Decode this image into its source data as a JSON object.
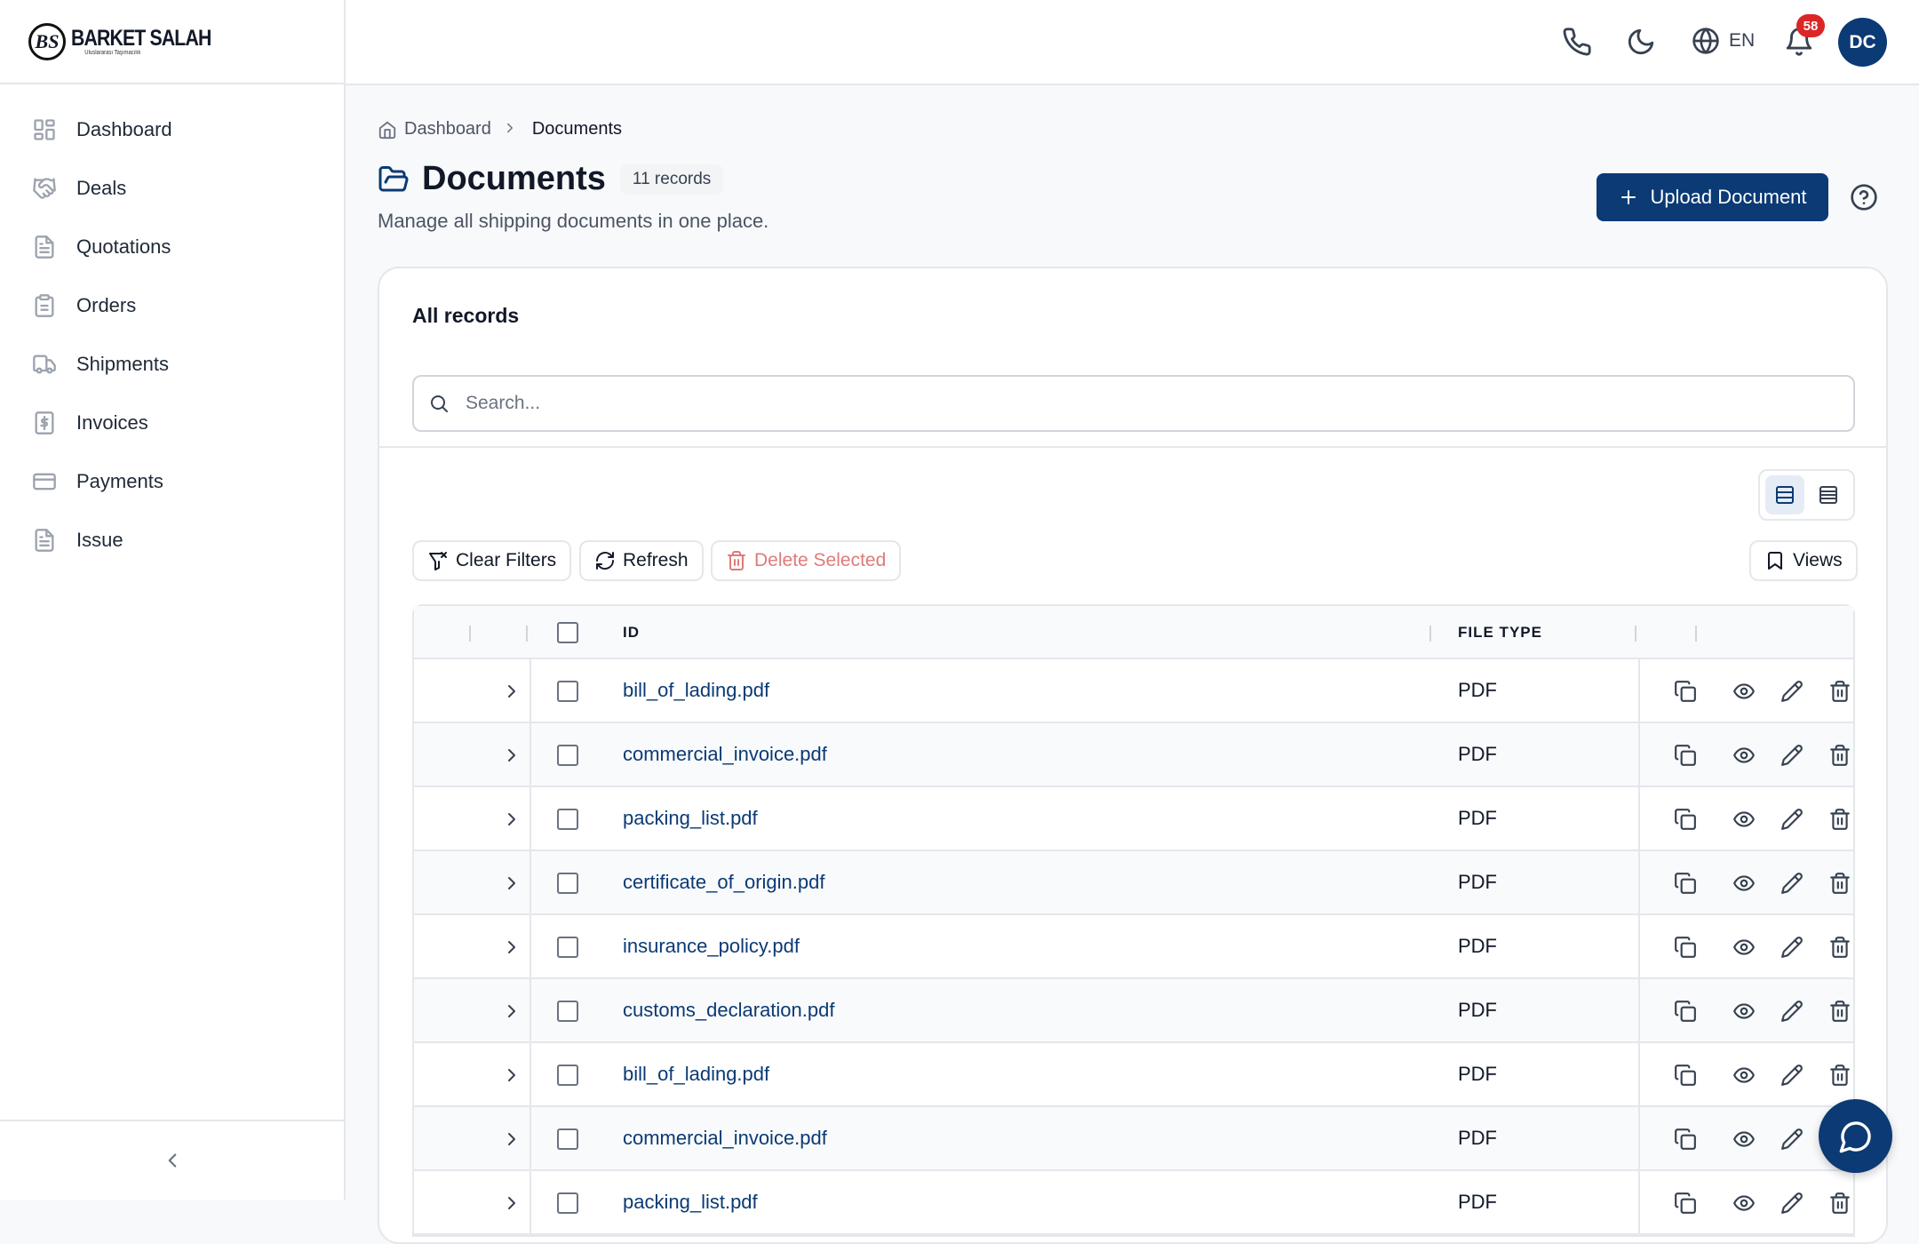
{
  "brand": {
    "mark": "BS",
    "name": "BARKET SALAH",
    "tagline": "Uluslararası Taşımacılık"
  },
  "sidebar": {
    "items": [
      {
        "label": "Dashboard",
        "icon": "grid-icon"
      },
      {
        "label": "Deals",
        "icon": "handshake-icon"
      },
      {
        "label": "Quotations",
        "icon": "document-icon"
      },
      {
        "label": "Orders",
        "icon": "clipboard-icon"
      },
      {
        "label": "Shipments",
        "icon": "truck-icon"
      },
      {
        "label": "Invoices",
        "icon": "invoice-icon"
      },
      {
        "label": "Payments",
        "icon": "credit-card-icon"
      },
      {
        "label": "Issue",
        "icon": "document-icon"
      }
    ]
  },
  "header": {
    "language": "EN",
    "notifications_count": "58",
    "avatar_initials": "DC"
  },
  "breadcrumb": {
    "home": "Dashboard",
    "current": "Documents"
  },
  "page": {
    "title": "Documents",
    "record_count": "11 records",
    "subtitle": "Manage all shipping documents in one place.",
    "upload_label": "Upload Document"
  },
  "card": {
    "title": "All records",
    "search_placeholder": "Search...",
    "toolbar": {
      "clear_filters": "Clear Filters",
      "refresh": "Refresh",
      "delete_selected": "Delete Selected",
      "views": "Views"
    }
  },
  "table": {
    "columns": {
      "id": "ID",
      "file_type": "FILE TYPE"
    },
    "rows": [
      {
        "id": "bill_of_lading.pdf",
        "file_type": "PDF"
      },
      {
        "id": "commercial_invoice.pdf",
        "file_type": "PDF"
      },
      {
        "id": "packing_list.pdf",
        "file_type": "PDF"
      },
      {
        "id": "certificate_of_origin.pdf",
        "file_type": "PDF"
      },
      {
        "id": "insurance_policy.pdf",
        "file_type": "PDF"
      },
      {
        "id": "customs_declaration.pdf",
        "file_type": "PDF"
      },
      {
        "id": "bill_of_lading.pdf",
        "file_type": "PDF"
      },
      {
        "id": "commercial_invoice.pdf",
        "file_type": "PDF"
      },
      {
        "id": "packing_list.pdf",
        "file_type": "PDF"
      }
    ]
  },
  "colors": {
    "primary": "#0b3a75",
    "danger": "#dc2626",
    "danger_muted": "#e07a7a"
  }
}
